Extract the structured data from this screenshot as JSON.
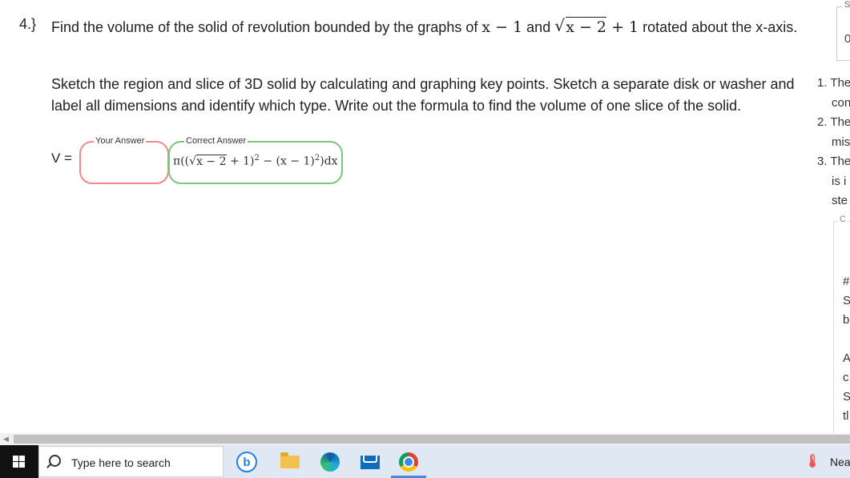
{
  "question": {
    "number": "4.}",
    "prefix": "Find the volume of the solid of revolution bounded by the graphs of ",
    "f1": "x − 1",
    "and": " and ",
    "f2_radicand": "x − 2",
    "f2_tail": " + 1",
    "suffix": " rotated about the x-axis.",
    "instructions": "Sketch the region and slice of 3D solid by calculating and graphing key points. Sketch a separate disk or washer and label all dimensions and identify which type. Write out the formula to find the volume of one slice of the solid."
  },
  "answer": {
    "v_label": "V =",
    "your_answer_label": "Your Answer",
    "your_answer_value": "",
    "correct_answer_label": "Correct Answer",
    "correct_pi": "π",
    "correct_open": "((",
    "correct_radicand": "x − 2",
    "correct_mid": " + 1)",
    "correct_exp1": "2",
    "correct_minus": " − (x − 1)",
    "correct_exp2": "2",
    "correct_close": ")dx"
  },
  "right_panel": {
    "legend_s": "S",
    "value": "0",
    "list": [
      "1. The",
      "con",
      "2. The",
      "mis",
      "3. The",
      "is i",
      "ste"
    ],
    "box_legend": "C",
    "box_lines": [
      "#",
      "S",
      "b",
      "",
      "A",
      "c",
      "S",
      "tl"
    ]
  },
  "taskbar": {
    "search_placeholder": "Type here to search",
    "bing_letter": "b",
    "weather_text": "Nea"
  }
}
